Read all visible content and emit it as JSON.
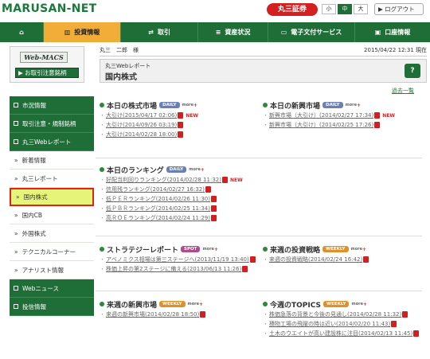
{
  "header": {
    "logo": "MARUSAN-NET",
    "brand": "丸三証券",
    "size": [
      "小",
      "中",
      "大"
    ],
    "logout": "ログアウト"
  },
  "nav": {
    "items": [
      {
        "label": "",
        "icon": "home-icon"
      },
      {
        "label": "投資情報",
        "icon": "chart-icon"
      },
      {
        "label": "取引",
        "icon": "trade-icon"
      },
      {
        "label": "資産状況",
        "icon": "database-icon"
      },
      {
        "label": "電子文付サービス",
        "icon": "monitor-icon"
      },
      {
        "label": "口座情報",
        "icon": "account-icon"
      }
    ]
  },
  "webmacs": {
    "logo": "Web-MACS",
    "button": "お取引注意銘柄"
  },
  "sidebar": [
    "市況情報",
    "取引注意・規制銘柄",
    "丸三Webレポート",
    "新着情報",
    "丸三レポート",
    "国内株式",
    "国内CB",
    "外国株式",
    "テクニカルコーナー",
    "アナリスト情報",
    "Webニュース",
    "投信情報"
  ],
  "crumb": {
    "user": "丸三　二郎　様",
    "datetime": "2015/04/22 12:31 現在"
  },
  "report": {
    "sub": "丸三Webレポート",
    "title": "国内株式",
    "help": "?"
  },
  "past": "過去一覧",
  "sections": {
    "market": {
      "title": "本日の株式市場",
      "tag": "DAILY",
      "more": "more",
      "items": [
        "大引け(2015/04/17 02:06)",
        "大引け(2014/09/26 03:19)",
        "大引け(2014/02/28 18:00)"
      ]
    },
    "newmarket": {
      "title": "本日の新興市場",
      "tag": "DAILY",
      "more": "more",
      "items": [
        "新興市場（大引け）(2014/02/27 17:34)",
        "新興市場（大引け）(2014/02/25 17:26)"
      ]
    },
    "ranking": {
      "title": "本日のランキング",
      "tag": "DAILY",
      "more": "more",
      "items": [
        "好配当利回りランキング(2014/02/28 11:32)",
        "信用残ランキング(2014/02/27 16:32)",
        "低ＰＥＲランキング(2014/02/26 11:30)",
        "低ＰＢＲランキング(2014/02/25 11:34)",
        "高ＲＯＥランキング(2014/02/24 11:29)"
      ]
    },
    "strategy": {
      "title": "ストラテジーレポート",
      "tag": "SPOT",
      "more": "more",
      "items": [
        "アベノミクス相場は第三ステージへ(2013/11/19 13:40)",
        "株価上昇の第2ステージに備える(2013/06/13 11:26)"
      ]
    },
    "nextweek": {
      "title": "来週の投資戦略",
      "tag": "WEEKLY",
      "more": "more",
      "items": [
        "来週の投資戦略(2014/02/24 16:42)"
      ]
    },
    "weeknew": {
      "title": "来週の新興市場",
      "tag": "WEEKLY",
      "more": "more",
      "items": [
        "来週の新興市場(2014/02/28 18:50)"
      ]
    },
    "topics": {
      "title": "今週のTOPICS",
      "tag": "WEEKLY",
      "more": "more",
      "items": [
        "株価急落の背景と今後の見通し(2014/02/28 11:32)",
        "積物工場の飛躍の時は近い(2014/02/20 11:43)",
        "土木のウエイトが高い建設株に注目(2014/02/13 11:45)"
      ]
    }
  },
  "new_label": "NEW"
}
